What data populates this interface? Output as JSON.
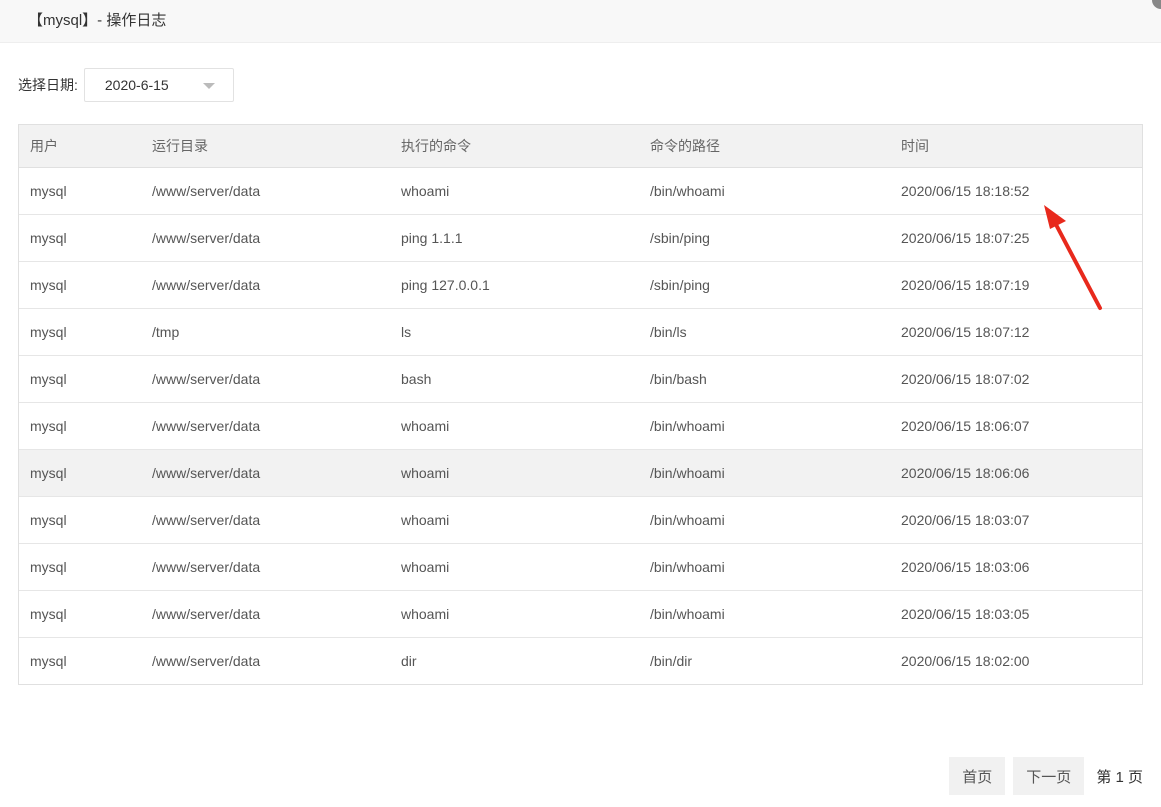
{
  "window": {
    "title": "【mysql】- 操作日志"
  },
  "filter": {
    "label": "选择日期:",
    "date_value": "2020-6-15"
  },
  "table": {
    "columns": [
      "用户",
      "运行目录",
      "执行的命令",
      "命令的路径",
      "时间"
    ],
    "rows": [
      [
        "mysql",
        "/www/server/data",
        "whoami",
        "/bin/whoami",
        "2020/06/15 18:18:52"
      ],
      [
        "mysql",
        "/www/server/data",
        "ping 1.1.1",
        "/sbin/ping",
        "2020/06/15 18:07:25"
      ],
      [
        "mysql",
        "/www/server/data",
        "ping 127.0.0.1",
        "/sbin/ping",
        "2020/06/15 18:07:19"
      ],
      [
        "mysql",
        "/tmp",
        "ls",
        "/bin/ls",
        "2020/06/15 18:07:12"
      ],
      [
        "mysql",
        "/www/server/data",
        "bash",
        "/bin/bash",
        "2020/06/15 18:07:02"
      ],
      [
        "mysql",
        "/www/server/data",
        "whoami",
        "/bin/whoami",
        "2020/06/15 18:06:07"
      ],
      [
        "mysql",
        "/www/server/data",
        "whoami",
        "/bin/whoami",
        "2020/06/15 18:06:06"
      ],
      [
        "mysql",
        "/www/server/data",
        "whoami",
        "/bin/whoami",
        "2020/06/15 18:03:07"
      ],
      [
        "mysql",
        "/www/server/data",
        "whoami",
        "/bin/whoami",
        "2020/06/15 18:03:06"
      ],
      [
        "mysql",
        "/www/server/data",
        "whoami",
        "/bin/whoami",
        "2020/06/15 18:03:05"
      ],
      [
        "mysql",
        "/www/server/data",
        "dir",
        "/bin/dir",
        "2020/06/15 18:02:00"
      ]
    ],
    "highlighted_row": 6
  },
  "pager": {
    "first_label": "首页",
    "next_label": "下一页",
    "current_label": "第 1 页"
  },
  "colors": {
    "annotation_arrow": "#e8291c",
    "header_bg": "#f2f2f2"
  },
  "icons": {
    "select_caret": "chevron-down-icon",
    "annotation": "red-arrow-icon"
  }
}
